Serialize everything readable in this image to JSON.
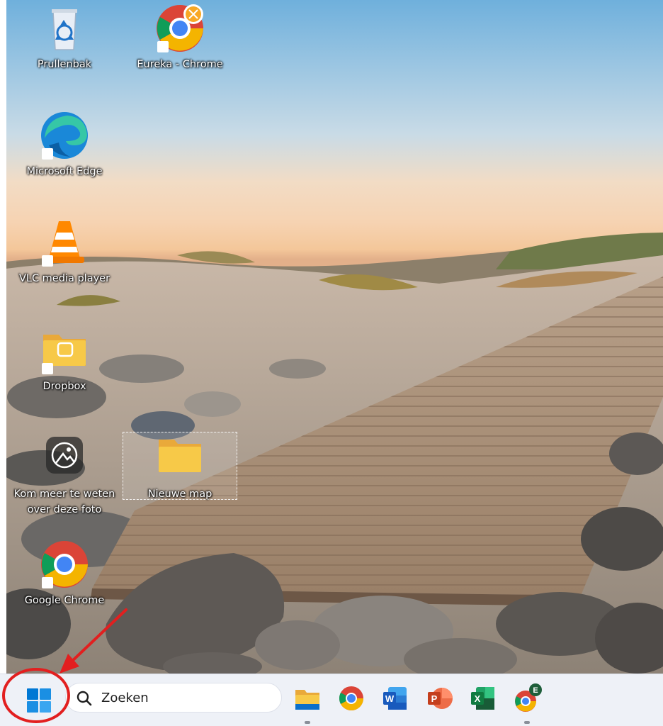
{
  "desktop": {
    "icons": [
      {
        "name": "recycle-bin",
        "label": "Prullenbak",
        "icon": "recycle-bin-icon"
      },
      {
        "name": "eureka-chrome",
        "label": "Eureka - Chrome",
        "icon": "chrome-profile-icon"
      },
      {
        "name": "microsoft-edge",
        "label": "Microsoft Edge",
        "icon": "edge-icon"
      },
      {
        "name": "vlc-media-player",
        "label": "VLC media player",
        "icon": "vlc-icon"
      },
      {
        "name": "dropbox",
        "label": "Dropbox",
        "icon": "dropbox-folder-icon"
      },
      {
        "name": "learn-about-photo",
        "label_line1": "Kom meer te weten",
        "label_line2": "over deze foto",
        "icon": "camera-info-icon"
      },
      {
        "name": "new-folder",
        "label": "Nieuwe map",
        "icon": "folder-icon"
      },
      {
        "name": "google-chrome",
        "label": "Google Chrome",
        "icon": "chrome-icon"
      }
    ]
  },
  "taskbar": {
    "start_icon": "windows-start-icon",
    "search": {
      "placeholder": "Zoeken",
      "icon": "search-icon"
    },
    "apps": [
      {
        "name": "file-explorer",
        "icon": "file-explorer-icon",
        "running": true
      },
      {
        "name": "chrome",
        "icon": "chrome-icon",
        "running": false
      },
      {
        "name": "word",
        "icon": "word-icon",
        "badge": "W",
        "running": false
      },
      {
        "name": "powerpoint",
        "icon": "powerpoint-icon",
        "badge": "P",
        "running": false
      },
      {
        "name": "excel",
        "icon": "excel-icon",
        "badge": "X",
        "running": false
      },
      {
        "name": "chrome-profile-e",
        "icon": "chrome-profile-icon",
        "badge": "E",
        "running": true
      }
    ]
  },
  "annotation": {
    "color": "#e21f1f",
    "target": "start-button"
  },
  "colors": {
    "taskbar_bg": "#eef1f7",
    "windows_blue": "#0078d4",
    "word_blue": "#185abd",
    "powerpoint_orange": "#c43e1c",
    "excel_green": "#107c41",
    "folder_yellow": "#f7c948"
  }
}
